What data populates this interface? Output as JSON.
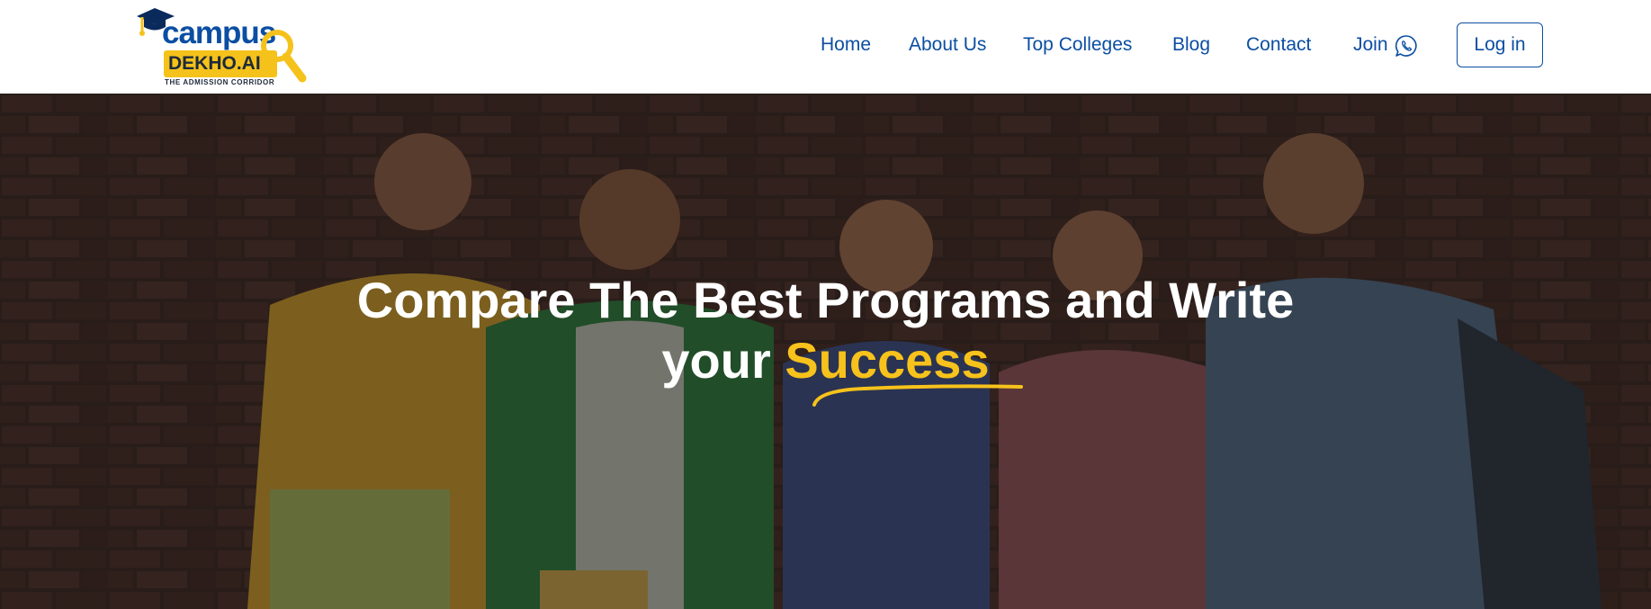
{
  "header": {
    "logo": {
      "campus": "campus",
      "badge": "DEKHO.AI",
      "tagline": "THE ADMISSION CORRIDOR"
    },
    "nav": [
      {
        "label": "Home"
      },
      {
        "label": "About Us"
      },
      {
        "label": "Top Colleges"
      },
      {
        "label": "Blog"
      },
      {
        "label": "Contact"
      },
      {
        "label": "Join",
        "icon": "whatsapp-icon"
      }
    ],
    "login_label": "Log in"
  },
  "hero": {
    "title_line1": "Compare The Best Programs and Write",
    "title_line2_prefix": "your",
    "title_line2_accent": "Success"
  },
  "colors": {
    "brand_blue": "#0b4ea2",
    "accent_yellow": "#f7c21b",
    "text_white": "#ffffff"
  }
}
